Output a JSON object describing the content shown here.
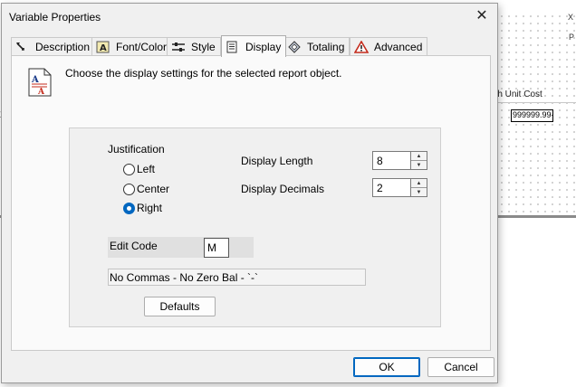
{
  "background": {
    "column_header": "eth  Unit Cost",
    "field_value": "999999.99-",
    "left_mark": "X",
    "right_mark_top": "X",
    "right_mark_mid": "P"
  },
  "dialog": {
    "title": "Variable Properties",
    "close_icon": "close-icon",
    "tabs": [
      {
        "label": "Description",
        "icon": "description-icon",
        "active": false
      },
      {
        "label": "Font/Color",
        "icon": "font-color-icon",
        "active": false
      },
      {
        "label": "Style",
        "icon": "style-icon",
        "active": false
      },
      {
        "label": "Display",
        "icon": "display-icon",
        "active": true
      },
      {
        "label": "Totaling",
        "icon": "totaling-icon",
        "active": false
      },
      {
        "label": "Advanced",
        "icon": "warning-icon",
        "active": false
      }
    ],
    "instructions": "Choose the display settings for the selected report object.",
    "justification": {
      "label": "Justification",
      "options": [
        {
          "label": "Left",
          "selected": false
        },
        {
          "label": "Center",
          "selected": false
        },
        {
          "label": "Right",
          "selected": true
        }
      ]
    },
    "display_length": {
      "label": "Display Length",
      "value": "8"
    },
    "display_decimals": {
      "label": "Display Decimals",
      "value": "2"
    },
    "edit_code": {
      "label": "Edit Code",
      "value": "M"
    },
    "edit_code_description": "No Commas -  No Zero Bal - `-`",
    "defaults_label": "Defaults",
    "ok_label": "OK",
    "cancel_label": "Cancel"
  },
  "colors": {
    "accent": "#0067c0",
    "warning": "#c42b1c",
    "dialog_bg": "#f0f0f0"
  }
}
